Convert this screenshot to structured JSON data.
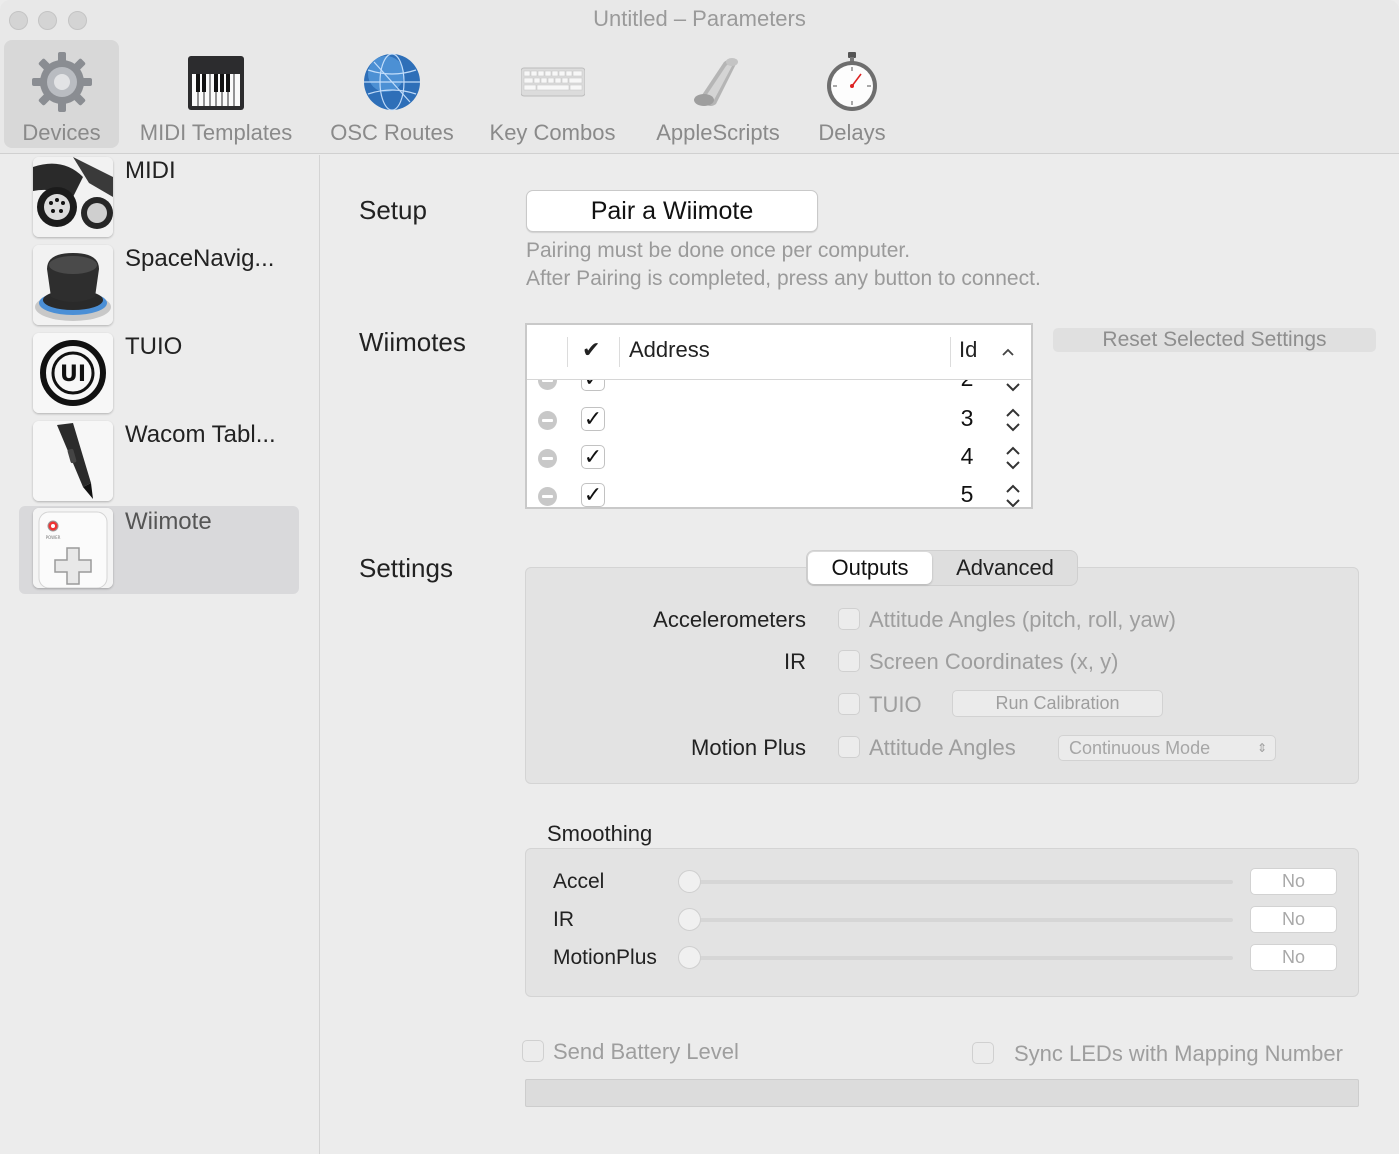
{
  "window": {
    "title": "Untitled – Parameters"
  },
  "toolbar": {
    "items": [
      {
        "label": "Devices",
        "icon": "gear-icon"
      },
      {
        "label": "MIDI Templates",
        "icon": "piano-icon"
      },
      {
        "label": "OSC Routes",
        "icon": "globe-icon"
      },
      {
        "label": "Key Combos",
        "icon": "keyboard-icon"
      },
      {
        "label": "AppleScripts",
        "icon": "script-icon"
      },
      {
        "label": "Delays",
        "icon": "stopwatch-icon"
      }
    ]
  },
  "sidebar": {
    "items": [
      {
        "label": "MIDI",
        "icon": "midi-connector-icon"
      },
      {
        "label": "SpaceNavig...",
        "icon": "space-navigator-icon"
      },
      {
        "label": "TUIO",
        "icon": "tuio-icon"
      },
      {
        "label": "Wacom Tabl...",
        "icon": "wacom-pen-icon"
      },
      {
        "label": "Wiimote",
        "icon": "wiimote-icon",
        "selected": true
      }
    ]
  },
  "setup": {
    "label": "Setup",
    "pair_button": "Pair a Wiimote",
    "hint_line1": "Pairing must be done once per computer.",
    "hint_line2": "After Pairing is completed, press any button to connect."
  },
  "wiimotes": {
    "label": "Wiimotes",
    "columns": {
      "check": "✔",
      "address": "Address",
      "id": "Id"
    },
    "rows": [
      {
        "checked": "✓",
        "address": "",
        "id": "2"
      },
      {
        "checked": "✓",
        "address": "",
        "id": "3"
      },
      {
        "checked": "✓",
        "address": "",
        "id": "4"
      },
      {
        "checked": "✓",
        "address": "",
        "id": "5"
      }
    ],
    "reset_button": "Reset Selected Settings"
  },
  "settings": {
    "label": "Settings",
    "tabs": {
      "outputs": "Outputs",
      "advanced": "Advanced"
    },
    "accelerometers_label": "Accelerometers",
    "accelerometers_option": "Attitude Angles (pitch, roll, yaw)",
    "ir_label": "IR",
    "ir_option": "Screen Coordinates (x, y)",
    "tuio_option": "TUIO",
    "run_calibration": "Run Calibration",
    "motion_plus_label": "Motion Plus",
    "motion_plus_option": "Attitude Angles",
    "mode_select": "Continuous Mode"
  },
  "smoothing": {
    "title": "Smoothing",
    "rows": [
      {
        "label": "Accel",
        "value": "No"
      },
      {
        "label": "IR",
        "value": "No"
      },
      {
        "label": "MotionPlus",
        "value": "No"
      }
    ]
  },
  "options": {
    "battery": "Send Battery Level",
    "sync_leds": "Sync LEDs with Mapping Number"
  }
}
